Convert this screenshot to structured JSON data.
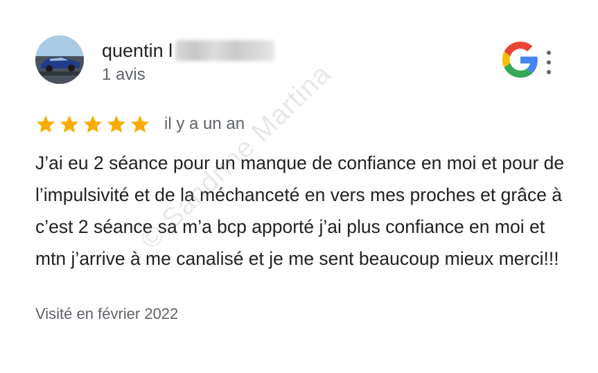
{
  "review": {
    "author_name": "quentin l",
    "review_count": "1 avis",
    "rating": 5,
    "max_rating": 5,
    "time_ago": "il y a un an",
    "text": "J’ai eu 2 séance pour un manque de confiance en moi et pour de l’impulsivité et de la méchanceté en vers mes proches et grâce à c’est 2 séance sa m’a bcp apporté j’ai plus confiance en moi et mtn j’arrive à me canalisé et je me sent beaucoup mieux merci!!!",
    "visit_date": "Visité en février 2022"
  },
  "watermark": "© Sandrine Martina",
  "icons": {
    "avatar": "car-avatar",
    "source_logo": "google-g-icon",
    "menu": "more-vert-icon",
    "star": "star-icon"
  },
  "colors": {
    "star": "#f9ab00",
    "primary_text": "#202124",
    "secondary_text": "#5f6368",
    "google_blue": "#4285f4",
    "google_red": "#ea4335",
    "google_yellow": "#fbbc05",
    "google_green": "#34a853"
  }
}
